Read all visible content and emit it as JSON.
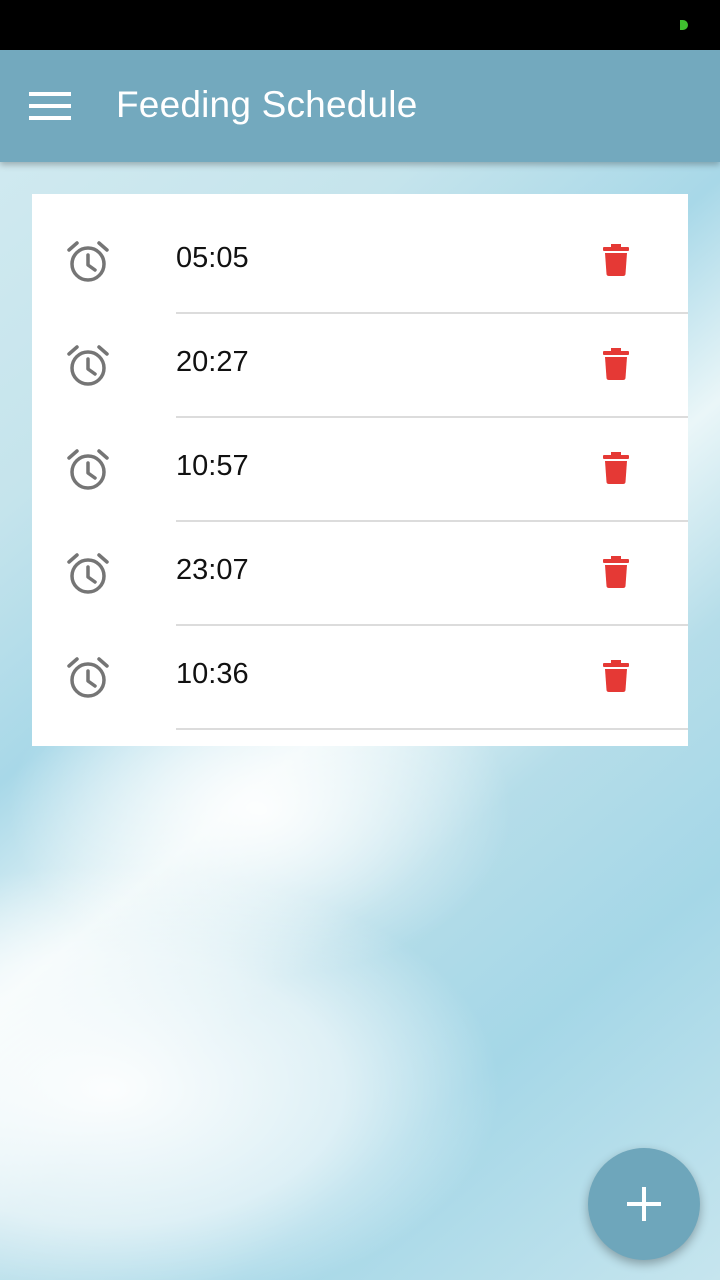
{
  "app_bar": {
    "title": "Feeding Schedule",
    "menu_icon": "hamburger-menu-icon"
  },
  "schedule": {
    "items": [
      {
        "time": "05:05"
      },
      {
        "time": "20:27"
      },
      {
        "time": "10:57"
      },
      {
        "time": "23:07"
      },
      {
        "time": "10:36"
      }
    ],
    "item_icon": "alarm-clock-icon",
    "delete_icon": "trash-icon"
  },
  "fab": {
    "icon": "plus-icon"
  },
  "colors": {
    "app_bar": "#73a9be",
    "fab": "#6ea6bb",
    "delete": "#e53935",
    "icon_gray": "#757575"
  }
}
